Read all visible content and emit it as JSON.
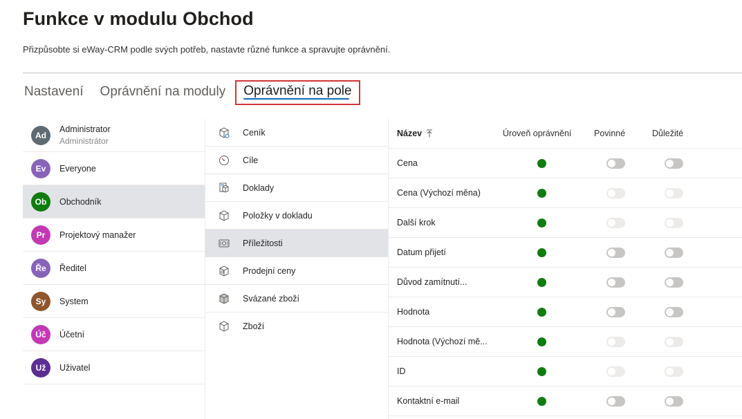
{
  "header": {
    "title": "Funkce v modulu Obchod",
    "subtitle": "Přizpůsobte si eWay-CRM podle svých potřeb, nastavte různé funkce a spravujte oprávnění."
  },
  "tabs": [
    {
      "label": "Nastavení",
      "active": false
    },
    {
      "label": "Oprávnění na moduly",
      "active": false
    },
    {
      "label": "Oprávnění na pole",
      "active": true
    }
  ],
  "roles": [
    {
      "initials": "Ad",
      "name": "Administrator",
      "sub": "Administrátor",
      "color": "#5f6b72",
      "selected": false
    },
    {
      "initials": "Ev",
      "name": "Everyone",
      "sub": "",
      "color": "#8764b8",
      "selected": false
    },
    {
      "initials": "Ob",
      "name": "Obchodník",
      "sub": "",
      "color": "#107c10",
      "selected": true
    },
    {
      "initials": "Pr",
      "name": "Projektový manažer",
      "sub": "",
      "color": "#c239b3",
      "selected": false
    },
    {
      "initials": "Ře",
      "name": "Ředitel",
      "sub": "",
      "color": "#8764b8",
      "selected": false
    },
    {
      "initials": "Sy",
      "name": "System",
      "sub": "",
      "color": "#8e562e",
      "selected": false
    },
    {
      "initials": "Úč",
      "name": "Účetní",
      "sub": "",
      "color": "#c239b3",
      "selected": false
    },
    {
      "initials": "Už",
      "name": "Uživatel",
      "sub": "",
      "color": "#5c2e91",
      "selected": false
    }
  ],
  "modules": [
    {
      "name": "Ceník",
      "icon": "price-list-icon",
      "selected": false
    },
    {
      "name": "Cíle",
      "icon": "goals-icon",
      "selected": false
    },
    {
      "name": "Doklady",
      "icon": "documents-icon",
      "selected": false
    },
    {
      "name": "Položky v dokladu",
      "icon": "document-items-icon",
      "selected": false
    },
    {
      "name": "Příležitosti",
      "icon": "opportunities-icon",
      "selected": true
    },
    {
      "name": "Prodejní ceny",
      "icon": "sales-prices-icon",
      "selected": false
    },
    {
      "name": "Svázané zboží",
      "icon": "bundled-goods-icon",
      "selected": false
    },
    {
      "name": "Zboží",
      "icon": "goods-icon",
      "selected": false
    }
  ],
  "fields_header": {
    "name": "Název",
    "level": "Úroveň oprávnění",
    "required": "Povinné",
    "important": "Důležité"
  },
  "fields": [
    {
      "name": "Cena",
      "status_color": "#107c10",
      "required_enabled": true,
      "important_enabled": true
    },
    {
      "name": "Cena (Výchozí měna)",
      "status_color": "#107c10",
      "required_enabled": false,
      "important_enabled": false
    },
    {
      "name": "Další krok",
      "status_color": "#107c10",
      "required_enabled": false,
      "important_enabled": false
    },
    {
      "name": "Datum přijetí",
      "status_color": "#107c10",
      "required_enabled": true,
      "important_enabled": true
    },
    {
      "name": "Důvod zamítnutí...",
      "status_color": "#107c10",
      "required_enabled": true,
      "important_enabled": true
    },
    {
      "name": "Hodnota",
      "status_color": "#107c10",
      "required_enabled": true,
      "important_enabled": true
    },
    {
      "name": "Hodnota (Výchozí mě...",
      "status_color": "#107c10",
      "required_enabled": false,
      "important_enabled": false
    },
    {
      "name": "ID",
      "status_color": "#107c10",
      "required_enabled": false,
      "important_enabled": false
    },
    {
      "name": "Kontaktní e-mail",
      "status_color": "#107c10",
      "required_enabled": true,
      "important_enabled": true
    }
  ]
}
